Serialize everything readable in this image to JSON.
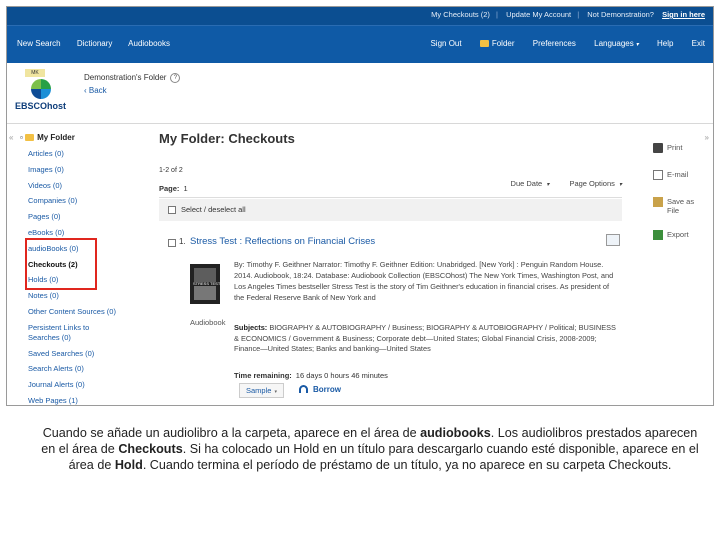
{
  "topbar": {
    "links": [
      "My Checkouts (2)",
      "Update My Account",
      "Not Demonstration?",
      "Sign in here"
    ]
  },
  "nav": {
    "left": [
      "New Search",
      "Dictionary",
      "Audiobooks"
    ],
    "right": [
      "Sign Out",
      "Folder",
      "Preferences",
      "Languages",
      "Help",
      "Exit"
    ]
  },
  "header": {
    "logo_flag": "MK",
    "logo_word": "EBSCOhost",
    "folder_label": "Demonstration's Folder",
    "back_link": "‹ Back"
  },
  "sidebar": {
    "title": "My Folder",
    "items": [
      "Articles (0)",
      "Images (0)",
      "Videos (0)",
      "Companies (0)",
      "Pages (0)",
      "eBooks (0)",
      "audioBooks (0)",
      "Checkouts (2)",
      "Holds (0)",
      "Notes (0)",
      "Other Content Sources (0)",
      "Persistent Links to Searches (0)",
      "Saved Searches (0)",
      "Search Alerts (0)",
      "Journal Alerts (0)",
      "Web Pages (1)"
    ]
  },
  "main": {
    "title": "My Folder: Checkouts",
    "count": "1-2 of 2",
    "page_label": "Page:",
    "page_value": "1",
    "sort": "Due Date",
    "page_options": "Page Options",
    "select_all": "Select / deselect all",
    "record": {
      "number": "1.",
      "title": "Stress Test : Reflections on Financial Crises",
      "cover_text": "STRESS TEST",
      "format": "Audiobook",
      "description": "By: Timothy F. Geithner Narrator: Timothy F. Geithner Edition: Unabridged. [New York] : Penguin Random House. 2014. Audiobook, 18:24. Database: Audiobook Collection (EBSCOhost) The New York Times, Washington Post, and Los Angeles Times bestseller Stress Test is the story of Tim Geithner's education in financial crises. As president of the Federal Reserve Bank of New York and",
      "subjects_label": "Subjects:",
      "subjects": "BIOGRAPHY & AUTOBIOGRAPHY / Business; BIOGRAPHY & AUTOBIOGRAPHY / Political; BUSINESS & ECONOMICS / Government & Business; Corporate debt—United States; Global Financial Crisis, 2008-2009; Finance—United States; Banks and banking—United States",
      "time_label": "Time remaining:",
      "time_value": "16 days 0 hours 46 minutes",
      "sample_button": "Sample",
      "borrow_button": "Borrow"
    }
  },
  "tools": [
    "Print",
    "E-mail",
    "Save as File",
    "Export"
  ],
  "caption": {
    "p1": "Cuando se añade un audiolibro a la carpeta, aparece en el área de ",
    "b1": "audiobooks",
    "p2": ". Los audiolibros prestados aparecen en el área de ",
    "b2": "Checkouts",
    "p3": ". Si ha colocado un Hold en un título para descargarlo cuando esté disponible, aparece en el área de ",
    "b3": "Hold",
    "p4": ". Cuando termina el período de préstamo de un título, ya no aparece en su carpeta Checkouts."
  }
}
